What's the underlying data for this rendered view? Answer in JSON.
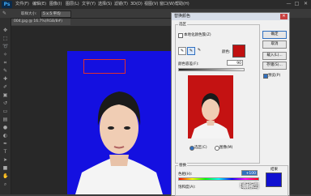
{
  "app": {
    "logo": "Ps"
  },
  "menu": [
    "文件(F)",
    "编辑(E)",
    "图像(I)",
    "图层(L)",
    "文字(Y)",
    "选择(S)",
    "滤镜(T)",
    "3D(D)",
    "视图(V)",
    "窗口(W)",
    "帮助(H)"
  ],
  "window_controls": [
    "—",
    "□",
    "✕"
  ],
  "options": {
    "sample_label": "取样大小:",
    "sample_value": "5 x 5 平均"
  },
  "document": {
    "tab": "004.jpg @ 16.7%(RGB/8#)"
  },
  "dialog": {
    "title": "替换颜色",
    "selection_group": "选区",
    "localized_clusters": "本地化颜色簇(Z)",
    "color_label": "颜色:",
    "fuzziness_label": "颜色容差(F):",
    "fuzziness_value": "90",
    "radio_selection": "选区(C)",
    "radio_image": "图像(M)",
    "replace_group": "替换",
    "hue_label": "色相(H):",
    "hue_value": "+100",
    "saturation_label": "饱和度(A):",
    "saturation_value": "0",
    "color_result_label": "结果",
    "buttons": {
      "ok": "确定",
      "cancel": "取消",
      "load": "载入(L)...",
      "save": "存储(S)..."
    },
    "preview_label": "预览(P)",
    "selected_color": "#c01010",
    "result_color": "#1010d0"
  },
  "watermark": "域指南",
  "colors": {
    "photo_bg": "#1410e0",
    "preview_bg": "#c41212"
  }
}
